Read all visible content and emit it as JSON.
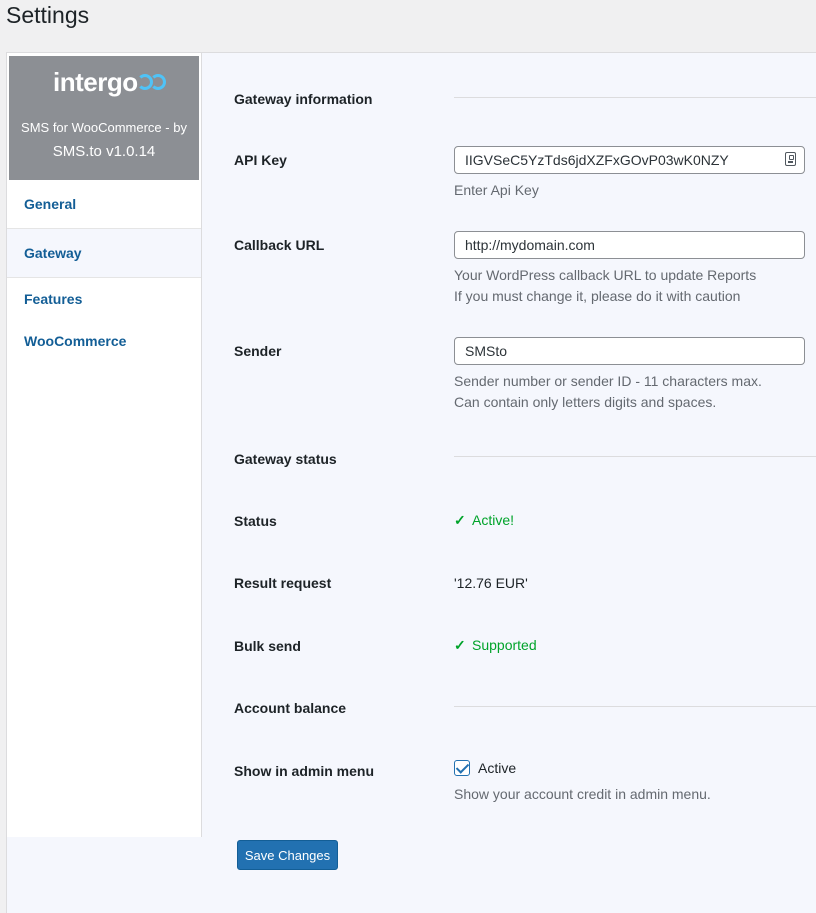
{
  "page": {
    "title": "Settings"
  },
  "brand": {
    "logo_text": "intergo",
    "line1": "SMS for WooCommerce - by",
    "line2": "SMS.to v1.0.14"
  },
  "nav": [
    {
      "label": "General"
    },
    {
      "label": "Gateway"
    },
    {
      "label": "Features"
    },
    {
      "label": "WooCommerce"
    }
  ],
  "gateway": {
    "section_title": "Gateway information",
    "api_key": {
      "label": "API Key",
      "value": "IIGVSeC5YzTds6jdXZFxGOvP03wK0NZY",
      "description": "Enter Api Key"
    },
    "callback": {
      "label": "Callback URL",
      "value": "http://mydomain.com",
      "description1": "Your WordPress callback URL to update Reports",
      "description2": "If you must change it, please do it with caution"
    },
    "sender": {
      "label": "Sender",
      "value": "SMSto",
      "description1": "Sender number or sender ID - 11 characters max.",
      "description2": "Can contain only letters digits and spaces."
    }
  },
  "status_section": {
    "section_title": "Gateway status",
    "status": {
      "label": "Status",
      "value": "Active!"
    },
    "result": {
      "label": "Result request",
      "value": "'12.76 EUR'"
    },
    "bulk": {
      "label": "Bulk send",
      "value": "Supported"
    }
  },
  "balance_section": {
    "section_title": "Account balance",
    "admin_menu": {
      "label": "Show in admin menu",
      "checkbox_label": "Active",
      "checked": true,
      "description": "Show your account credit in admin menu."
    }
  },
  "actions": {
    "save_label": "Save Changes"
  },
  "colors": {
    "accent": "#2271b1",
    "success": "#00a32a",
    "brand_bg": "#8c8f94"
  }
}
